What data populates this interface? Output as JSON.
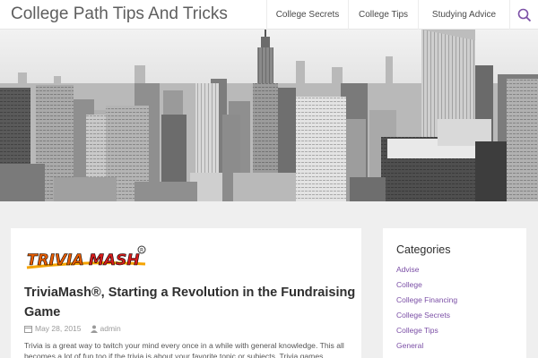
{
  "header": {
    "site_title": "College Path Tips And Tricks",
    "nav": [
      {
        "label": "College Secrets"
      },
      {
        "label": "College Tips"
      },
      {
        "label": "Studying Advice"
      }
    ],
    "search_icon": "search-icon"
  },
  "hero": {
    "image": "grayscale-city-skyline"
  },
  "post": {
    "logo_text": "TRIVIAMASH",
    "title": "TriviaMash®,     Starting a Revolution in the Fundraising Game",
    "date": "May 28, 2015",
    "author": "admin",
    "excerpt": "Trivia is a great way to twitch your mind every once in a while with general knowledge. This all becomes a lot of fun too if the trivia is about your favorite topic or subjects. Trivia games"
  },
  "sidebar": {
    "heading": "Categories",
    "categories": [
      "Advise",
      "College",
      "College Financing",
      "College Secrets",
      "College Tips",
      "General"
    ],
    "link_color": "#7b4fa6"
  }
}
